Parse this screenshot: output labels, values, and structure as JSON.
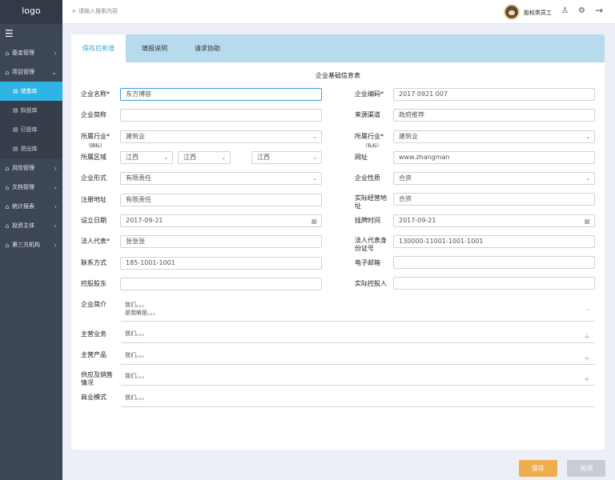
{
  "app": {
    "logo": "logo"
  },
  "sidebar": {
    "collapse_icon": "☰",
    "items": [
      {
        "label": "基金管理",
        "icon": "home-icon"
      },
      {
        "label": "项目管理",
        "icon": "home-icon"
      },
      {
        "label": "风险管理",
        "icon": "home-icon"
      },
      {
        "label": "文档管理",
        "icon": "home-icon"
      },
      {
        "label": "统计报表",
        "icon": "home-icon"
      },
      {
        "label": "投资主体",
        "icon": "home-icon"
      },
      {
        "label": "第三方机构",
        "icon": "home-icon"
      }
    ],
    "sub_items": [
      {
        "label": "储备库",
        "active": true
      },
      {
        "label": "拟投库"
      },
      {
        "label": "已投库"
      },
      {
        "label": "退出库"
      }
    ]
  },
  "topbar": {
    "search_placeholder": "请输入搜索内容",
    "username": "股权类员工"
  },
  "tabs": [
    "保存后新增",
    "填报说明",
    "请求协助"
  ],
  "form": {
    "title": "企业基础信息表",
    "labels": {
      "company_name": "企业名称*",
      "company_code": "企业编码*",
      "company_abbr": "企业简称",
      "source": "来源渠道",
      "industry_national": "所属行业*",
      "industry_national_sub": "（国标）",
      "industry_private": "所属行业*",
      "industry_private_sub": "（私标）",
      "region": "所属区域",
      "website": "网址",
      "company_form": "企业形式",
      "company_nature": "企业性质",
      "reg_address": "注册地址",
      "actual_address": "实际经营地址",
      "found_date": "设立日期",
      "listing_time": "挂牌时间",
      "legal_rep": "法人代表*",
      "legal_id": "法人代表身份证号",
      "contact": "联系方式",
      "email": "电子邮箱",
      "controlling_shareholder": "控股股东",
      "actual_controller": "实际控股人",
      "intro": "企业简介",
      "main_business": "主营业务",
      "main_products": "主营产品",
      "supply_sales": "供应及销售情况",
      "business_model": "商业模式"
    },
    "values": {
      "company_name": "东方博容",
      "company_code": "2017 0921 007",
      "company_abbr": "",
      "source": "政府推荐",
      "industry_national": "建筑业",
      "industry_private": "建筑业",
      "region": [
        "江西",
        "江西",
        "江西"
      ],
      "website": "www.zhangman",
      "company_form": "有限责任",
      "company_nature": "合资",
      "reg_address": "有限责任",
      "actual_address": "合资",
      "found_date": "2017-09-21",
      "listing_time": "2017-09-21",
      "legal_rep": "张张张",
      "legal_id": "130000-11001-1001-1001",
      "contact": "185-1001-1001",
      "email": "",
      "controlling_shareholder": "",
      "actual_controller": "",
      "intro_line1": "我们。。。",
      "intro_line2": "是我嘛是。。。",
      "main_business": "我们。。。",
      "main_products": "我们。。。",
      "supply_sales": "我们。。。",
      "business_model": "我们。。。"
    }
  },
  "buttons": {
    "save": "保存",
    "close": "关闭"
  }
}
